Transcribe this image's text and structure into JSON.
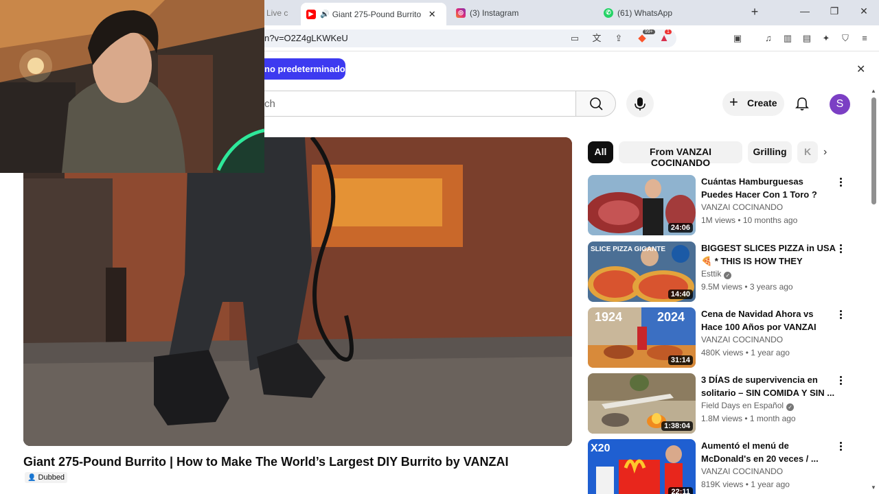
{
  "browser": {
    "tabs": [
      {
        "title": "Live c",
        "favicon": "live-favicon"
      },
      {
        "title": "Giant 275-Pound Burrito |",
        "favicon": "youtube-favicon",
        "active": true
      },
      {
        "title": "(3) Instagram",
        "favicon": "instagram-favicon"
      },
      {
        "title": "(61) WhatsApp",
        "favicon": "whatsapp-favicon"
      }
    ],
    "url": "n?v=O2Z4gLKWKeU",
    "brave_badge": "99+",
    "alert_badge": "1"
  },
  "banner": {
    "button_label": "no predeterminado"
  },
  "header": {
    "search_placeholder": "ch",
    "create_label": "Create",
    "avatar_letter": "S"
  },
  "video": {
    "title": "Giant 275-Pound Burrito | How to Make The World’s Largest DIY Burrito by VANZAI",
    "dubbed_label": "Dubbed"
  },
  "chips": [
    "All",
    "From VANZAI COCINANDO",
    "Grilling",
    "K"
  ],
  "recommendations": [
    {
      "title": "Cuántas Hamburguesas Puedes Hacer Con 1 Toro ?",
      "channel": "VANZAI COCINANDO",
      "verified": false,
      "meta": "1M views • 10 months ago",
      "duration": "24:06"
    },
    {
      "title": "BIGGEST SLICES PIZZA in USA 🍕 * THIS IS HOW THEY REAC...",
      "channel": "Esttik",
      "verified": true,
      "meta": "9.5M views • 3 years ago",
      "duration": "14:40"
    },
    {
      "title": "Cena de Navidad Ahora vs Hace 100 Años por VANZAI",
      "channel": "VANZAI COCINANDO",
      "verified": false,
      "meta": "480K views • 1 year ago",
      "duration": "31:14"
    },
    {
      "title": "3 DÍAS de supervivencia en solitario – SIN COMIDA Y SIN ...",
      "channel": "Field Days en Español",
      "verified": true,
      "meta": "1.8M views • 1 month ago",
      "duration": "1:38:04"
    },
    {
      "title": "Aumentó el menú de McDonald's en 20 veces / ...",
      "channel": "VANZAI COCINANDO",
      "verified": false,
      "meta": "819K views • 1 year ago",
      "duration": "22:11"
    }
  ],
  "thumb_texts": {
    "t1": "SLICE PIZZA GIGANTE",
    "t2a": "1924",
    "t2b": "2024",
    "t4": "X20"
  }
}
